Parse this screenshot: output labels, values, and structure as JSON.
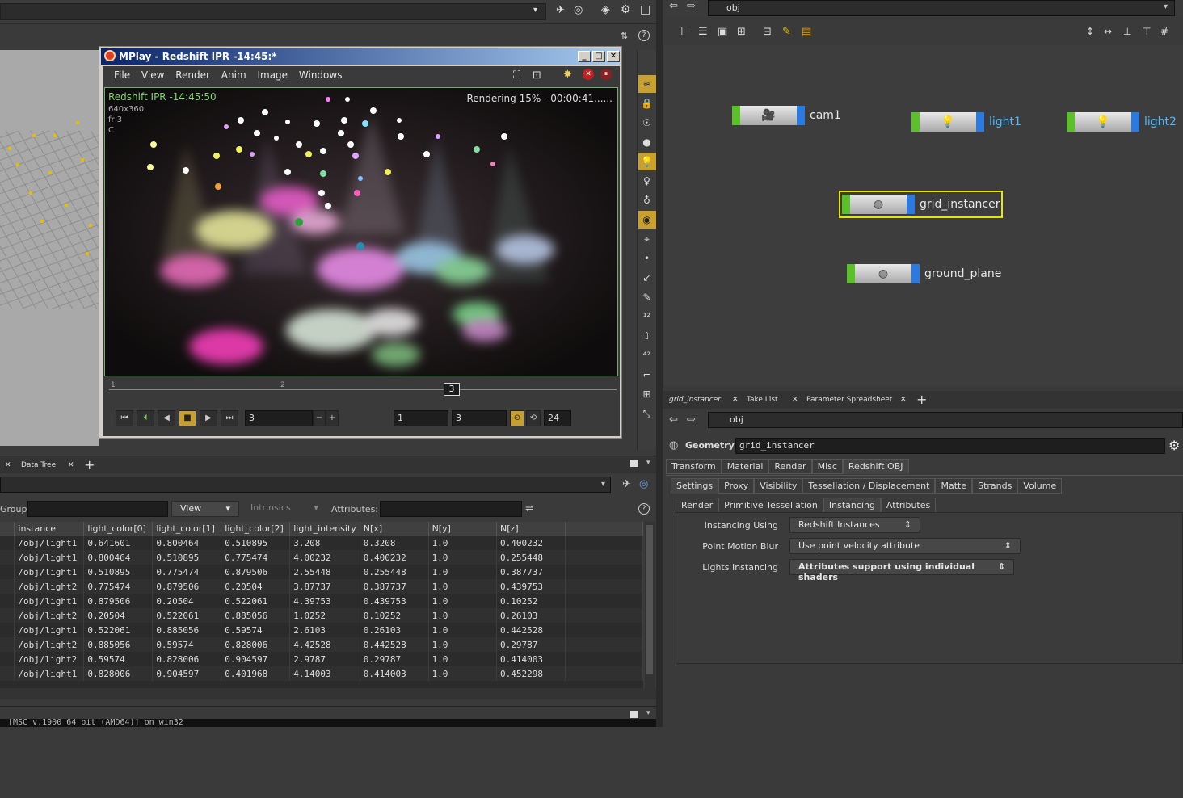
{
  "viewport": {},
  "mplay": {
    "title": "MPlay - Redshift IPR -14:45:*",
    "menu": [
      "File",
      "View",
      "Render",
      "Anim",
      "Image",
      "Windows"
    ],
    "render_info": "Redshift IPR -14:45:50",
    "render_res": "640x360",
    "render_frame": "fr 3",
    "render_c": "C",
    "render_status": "Rendering 15% - 00:00:41......",
    "tl_tick1": "1",
    "tl_tick2": "2",
    "current_frame": "3",
    "frame_field": "3",
    "range_start": "1",
    "range_end": "3",
    "end_frame": "24"
  },
  "left_tabs": {
    "data_tree": "Data Tree"
  },
  "spreadsheet": {
    "group_label": "Group:",
    "view_label": "View",
    "intrinsics_label": "Intrinsics",
    "attributes_label": "Attributes:",
    "columns": [
      "instance",
      "light_color[0]",
      "light_color[1]",
      "light_color[2]",
      "light_intensity",
      "N[x]",
      "N[y]",
      "N[z]"
    ],
    "rows": [
      [
        "/obj/light1",
        "0.641601",
        "0.800464",
        "0.510895",
        "3.208",
        "0.3208",
        "1.0",
        "0.400232"
      ],
      [
        "/obj/light1",
        "0.800464",
        "0.510895",
        "0.775474",
        "4.00232",
        "0.400232",
        "1.0",
        "0.255448"
      ],
      [
        "/obj/light1",
        "0.510895",
        "0.775474",
        "0.879506",
        "2.55448",
        "0.255448",
        "1.0",
        "0.387737"
      ],
      [
        "/obj/light2",
        "0.775474",
        "0.879506",
        "0.20504",
        "3.87737",
        "0.387737",
        "1.0",
        "0.439753"
      ],
      [
        "/obj/light1",
        "0.879506",
        "0.20504",
        "0.522061",
        "4.39753",
        "0.439753",
        "1.0",
        "0.10252"
      ],
      [
        "/obj/light2",
        "0.20504",
        "0.522061",
        "0.885056",
        "1.0252",
        "0.10252",
        "1.0",
        "0.26103"
      ],
      [
        "/obj/light1",
        "0.522061",
        "0.885056",
        "0.59574",
        "2.6103",
        "0.26103",
        "1.0",
        "0.442528"
      ],
      [
        "/obj/light2",
        "0.885056",
        "0.59574",
        "0.828006",
        "4.42528",
        "0.442528",
        "1.0",
        "0.29787"
      ],
      [
        "/obj/light2",
        "0.59574",
        "0.828006",
        "0.904597",
        "2.9787",
        "0.29787",
        "1.0",
        "0.414003"
      ],
      [
        "/obj/light1",
        "0.828006",
        "0.904597",
        "0.401968",
        "4.14003",
        "0.414003",
        "1.0",
        "0.452298"
      ]
    ]
  },
  "console": {
    "text": "[MSC v.1900 64 bit (AMD64)] on win32"
  },
  "network": {
    "path": "obj",
    "nodes": {
      "cam1": "cam1",
      "light1": "light1",
      "light2": "light2",
      "grid_instancer": "grid_instancer",
      "ground_plane": "ground_plane"
    }
  },
  "param_tabs": [
    "grid_instancer",
    "Take List",
    "Parameter Spreadsheet"
  ],
  "params": {
    "path": "obj",
    "type_label": "Geometry",
    "node_name": "grid_instancer",
    "tabs1": [
      "Transform",
      "Material",
      "Render",
      "Misc",
      "Redshift OBJ"
    ],
    "tabs2": [
      "Settings",
      "Proxy",
      "Visibility",
      "Tessellation / Displacement",
      "Matte",
      "Strands",
      "Volume"
    ],
    "tabs3": [
      "Render",
      "Primitive Tessellation",
      "Instancing",
      "Attributes"
    ],
    "instancing_using_label": "Instancing Using",
    "instancing_using_value": "Redshift Instances",
    "point_motion_blur_label": "Point Motion Blur",
    "point_motion_blur_value": "Use point velocity attribute",
    "lights_instancing_label": "Lights Instancing",
    "lights_instancing_value": "Attributes support using individual shaders"
  }
}
